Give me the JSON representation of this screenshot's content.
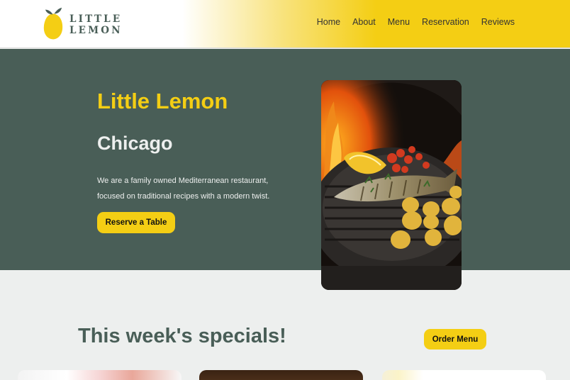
{
  "header": {
    "logo_text": "LITTLE LEMON",
    "nav": [
      "Home",
      "About",
      "Menu",
      "Reservation",
      "Reviews"
    ]
  },
  "hero": {
    "title": "Little Lemon",
    "subtitle": "Chicago",
    "description": "We are a family owned Mediterranean restaurant, focused on traditional recipes with a modern twist.",
    "button_label": "Reserve a Table"
  },
  "specials": {
    "title": "This week's specials!",
    "button_label": "Order Menu"
  },
  "colors": {
    "primary_green": "#495E57",
    "primary_yellow": "#F4CE14",
    "light_bg": "#EDEFEE"
  }
}
